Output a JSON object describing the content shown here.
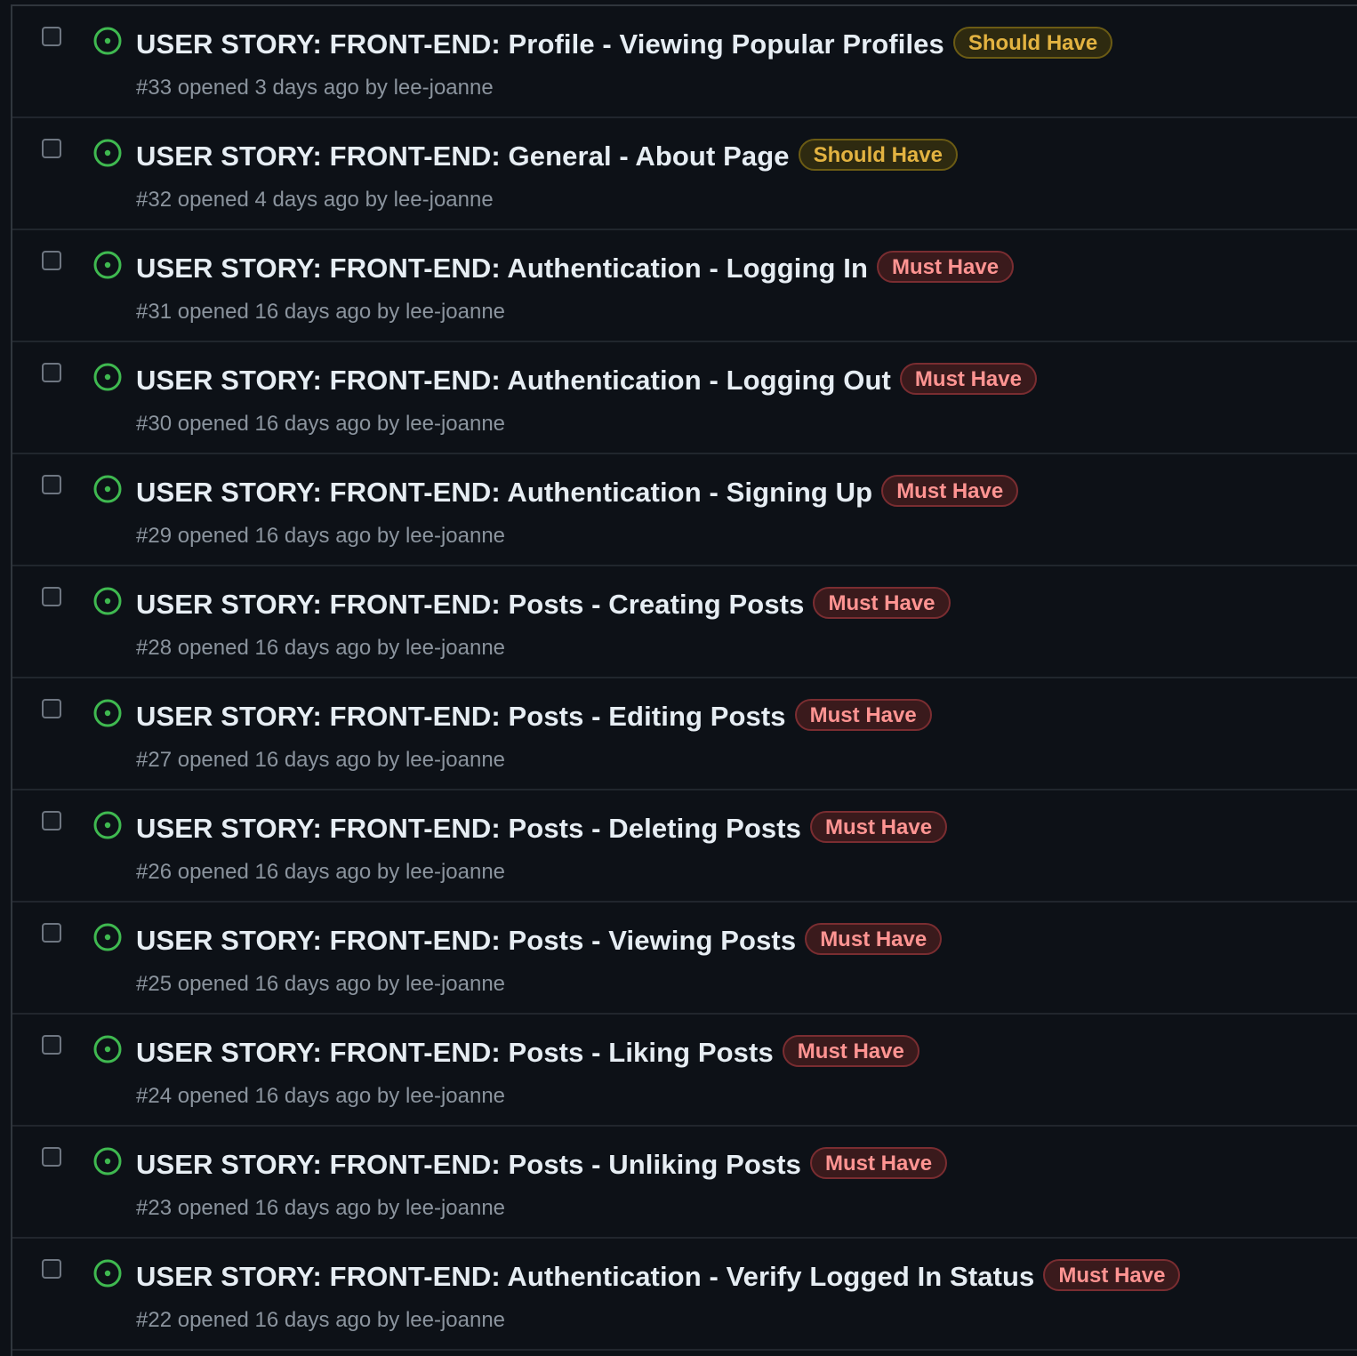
{
  "colors": {
    "background": "#0d1117",
    "open_icon": "#3fb950",
    "should_have": "#e3b341",
    "must_have": "#ff9492",
    "muted_text": "#8b949e"
  },
  "issues": [
    {
      "title": "USER STORY: FRONT-END: Profile - Viewing Popular Profiles",
      "label": "Should Have",
      "label_kind": "should",
      "number": "#33",
      "opened": "opened 3 days ago by",
      "author": "lee-joanne"
    },
    {
      "title": "USER STORY: FRONT-END: General - About Page",
      "label": "Should Have",
      "label_kind": "should",
      "number": "#32",
      "opened": "opened 4 days ago by",
      "author": "lee-joanne"
    },
    {
      "title": "USER STORY: FRONT-END: Authentication - Logging In",
      "label": "Must Have",
      "label_kind": "must",
      "number": "#31",
      "opened": "opened 16 days ago by",
      "author": "lee-joanne"
    },
    {
      "title": "USER STORY: FRONT-END: Authentication - Logging Out",
      "label": "Must Have",
      "label_kind": "must",
      "number": "#30",
      "opened": "opened 16 days ago by",
      "author": "lee-joanne"
    },
    {
      "title": "USER STORY: FRONT-END: Authentication - Signing Up",
      "label": "Must Have",
      "label_kind": "must",
      "number": "#29",
      "opened": "opened 16 days ago by",
      "author": "lee-joanne"
    },
    {
      "title": "USER STORY: FRONT-END: Posts - Creating Posts",
      "label": "Must Have",
      "label_kind": "must",
      "number": "#28",
      "opened": "opened 16 days ago by",
      "author": "lee-joanne"
    },
    {
      "title": "USER STORY: FRONT-END: Posts - Editing Posts",
      "label": "Must Have",
      "label_kind": "must",
      "number": "#27",
      "opened": "opened 16 days ago by",
      "author": "lee-joanne"
    },
    {
      "title": "USER STORY: FRONT-END: Posts - Deleting Posts",
      "label": "Must Have",
      "label_kind": "must",
      "number": "#26",
      "opened": "opened 16 days ago by",
      "author": "lee-joanne"
    },
    {
      "title": "USER STORY: FRONT-END: Posts - Viewing Posts",
      "label": "Must Have",
      "label_kind": "must",
      "number": "#25",
      "opened": "opened 16 days ago by",
      "author": "lee-joanne"
    },
    {
      "title": "USER STORY: FRONT-END: Posts - Liking Posts",
      "label": "Must Have",
      "label_kind": "must",
      "number": "#24",
      "opened": "opened 16 days ago by",
      "author": "lee-joanne"
    },
    {
      "title": "USER STORY: FRONT-END: Posts - Unliking Posts",
      "label": "Must Have",
      "label_kind": "must",
      "number": "#23",
      "opened": "opened 16 days ago by",
      "author": "lee-joanne"
    },
    {
      "title": "USER STORY: FRONT-END: Authentication - Verify Logged In Status",
      "label": "Must Have",
      "label_kind": "must",
      "number": "#22",
      "opened": "opened 16 days ago by",
      "author": "lee-joanne"
    }
  ]
}
